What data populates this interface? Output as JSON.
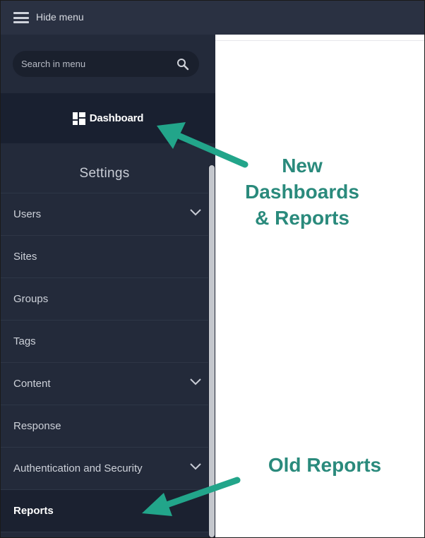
{
  "topbar": {
    "hide_menu_label": "Hide menu"
  },
  "search": {
    "placeholder": "Search in menu",
    "value": ""
  },
  "dashboard": {
    "label": "Dashboard"
  },
  "settings": {
    "heading": "Settings",
    "items": [
      {
        "label": "Users",
        "expandable": true
      },
      {
        "label": "Sites",
        "expandable": false
      },
      {
        "label": "Groups",
        "expandable": false
      },
      {
        "label": "Tags",
        "expandable": false
      },
      {
        "label": "Content",
        "expandable": true
      },
      {
        "label": "Response",
        "expandable": false
      },
      {
        "label": "Authentication and Security",
        "expandable": true
      },
      {
        "label": "Reports",
        "expandable": false,
        "active": true
      }
    ]
  },
  "annotations": {
    "new_line1": "New",
    "new_line2": "Dashboards",
    "new_line3": "& Reports",
    "old": "Old Reports"
  },
  "colors": {
    "topbar": "#2a3142",
    "sidebar": "#232a3a",
    "dashboard_bg": "#192030",
    "annotation_green": "#2a8a7c"
  },
  "icons": {
    "menu": "hamburger-icon",
    "search": "search-icon",
    "dashboard": "dashboard-grid-icon",
    "expand": "chevron-down-icon",
    "arrow": "arrow-icon"
  }
}
